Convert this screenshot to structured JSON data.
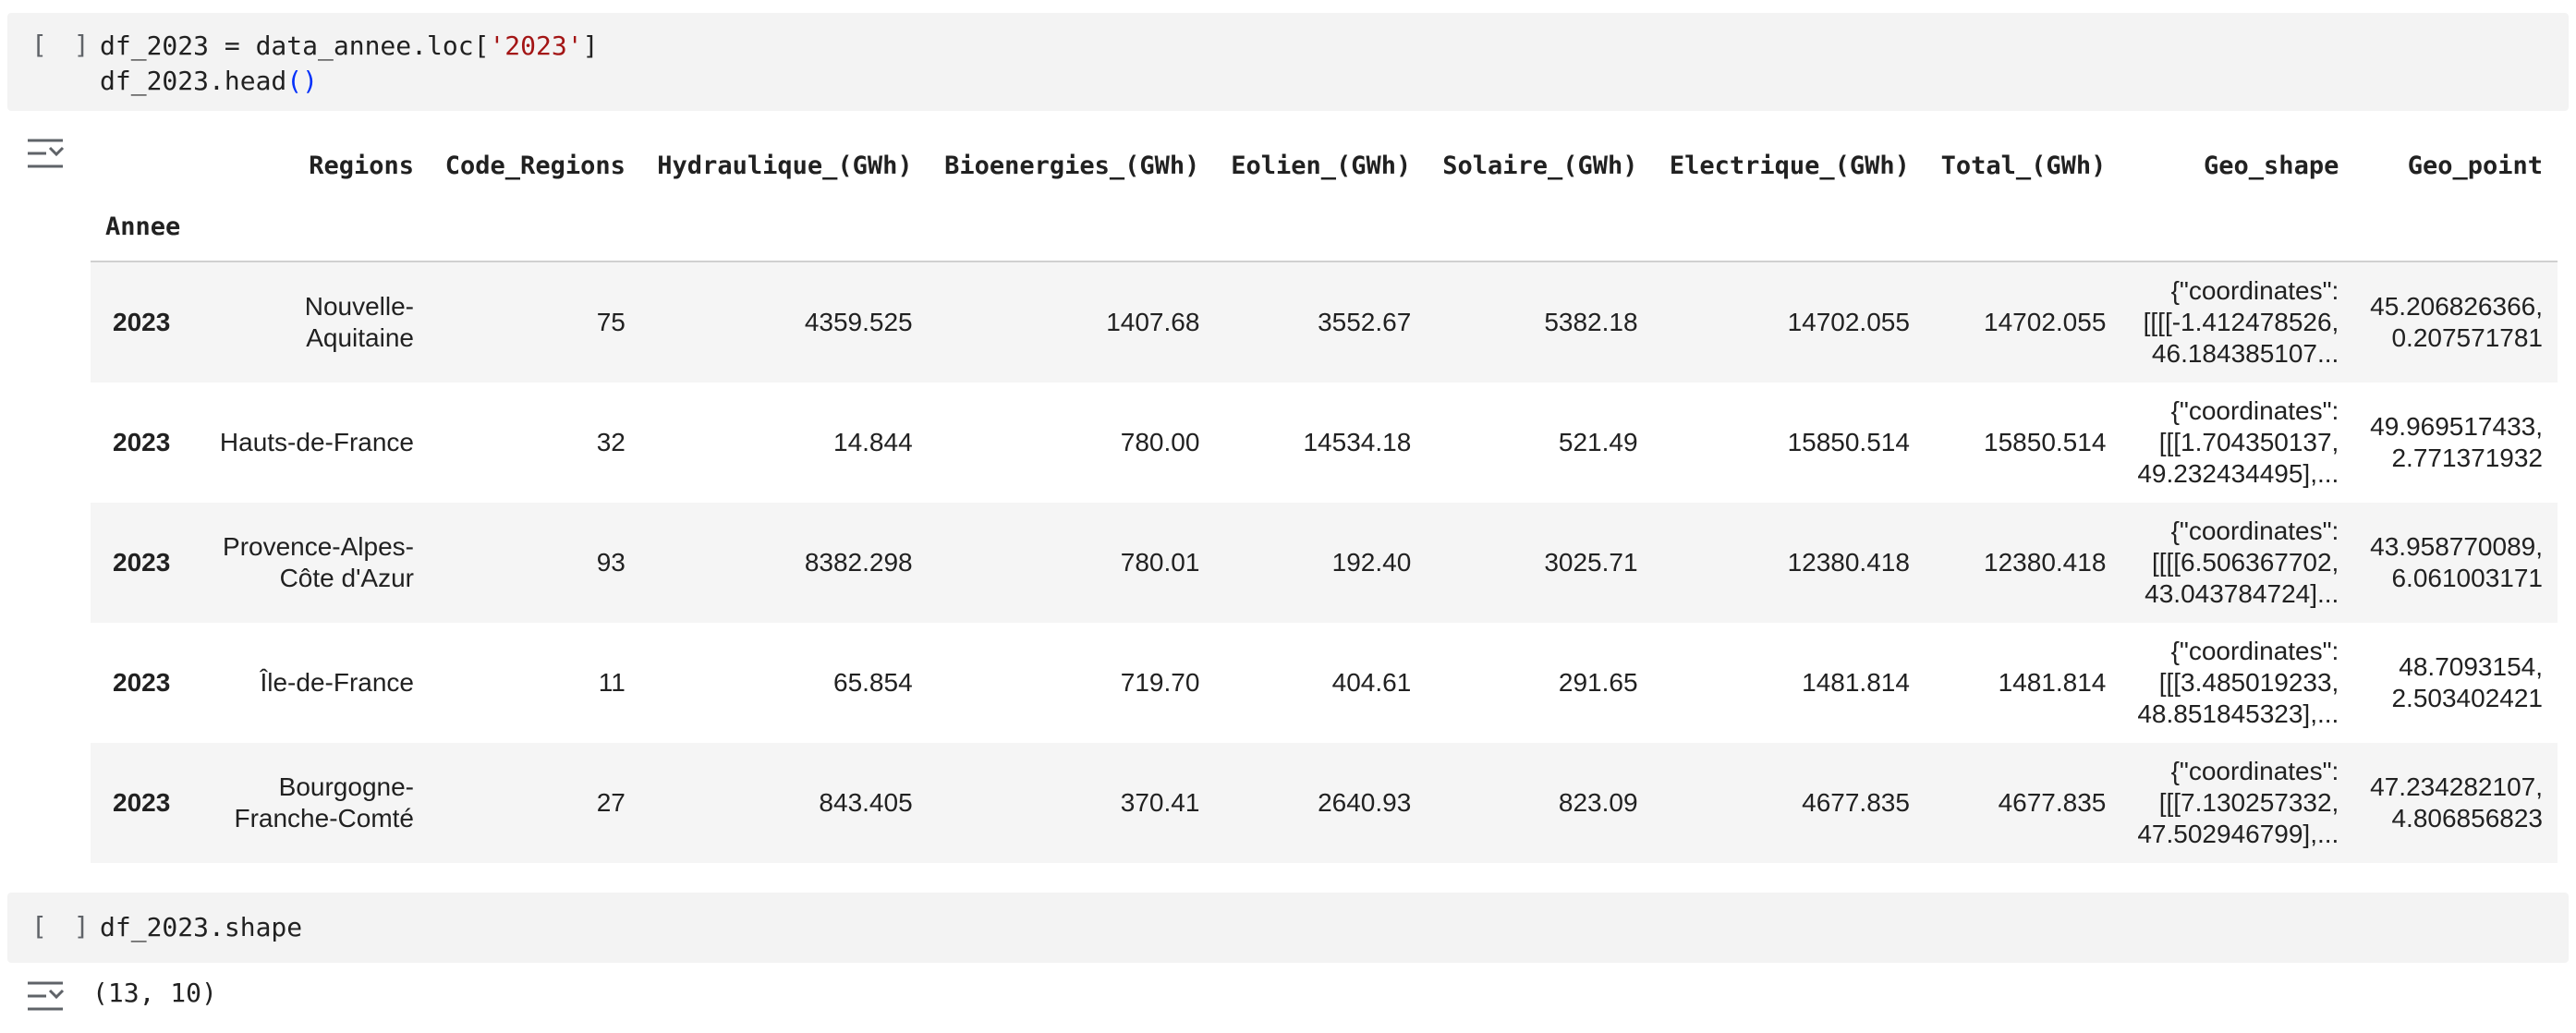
{
  "cell1": {
    "run_label": "[ ]",
    "code_line1_pre": "df_2023 = data_annee.loc[",
    "code_line1_str": "'2023'",
    "code_line1_post": "]",
    "code_line2_pre": "df_2023.head",
    "code_line2_paren": "()"
  },
  "output1": {
    "icon": "output-collapse-icon",
    "columns": [
      "Regions",
      "Code_Regions",
      "Hydraulique_(GWh)",
      "Bioenergies_(GWh)",
      "Eolien_(GWh)",
      "Solaire_(GWh)",
      "Electrique_(GWh)",
      "Total_(GWh)",
      "Geo_shape",
      "Geo_point"
    ],
    "index_name": "Annee",
    "rows": [
      {
        "annee": "2023",
        "regions": "Nouvelle-\nAquitaine",
        "code": "75",
        "hydraulique": "4359.525",
        "bioenergies": "1407.68",
        "eolien": "3552.67",
        "solaire": "5382.18",
        "electrique": "14702.055",
        "total": "14702.055",
        "geo_shape": "{\"coordinates\":\n[[[[-1.412478526,\n46.184385107...",
        "geo_point": "45.206826366,\n0.207571781"
      },
      {
        "annee": "2023",
        "regions": "Hauts-de-France",
        "code": "32",
        "hydraulique": "14.844",
        "bioenergies": "780.00",
        "eolien": "14534.18",
        "solaire": "521.49",
        "electrique": "15850.514",
        "total": "15850.514",
        "geo_shape": "{\"coordinates\":\n[[[1.704350137,\n49.232434495],...",
        "geo_point": "49.969517433,\n2.771371932"
      },
      {
        "annee": "2023",
        "regions": "Provence-Alpes-\nCôte d'Azur",
        "code": "93",
        "hydraulique": "8382.298",
        "bioenergies": "780.01",
        "eolien": "192.40",
        "solaire": "3025.71",
        "electrique": "12380.418",
        "total": "12380.418",
        "geo_shape": "{\"coordinates\":\n[[[[6.506367702,\n43.043784724]...",
        "geo_point": "43.958770089,\n6.061003171"
      },
      {
        "annee": "2023",
        "regions": "Île-de-France",
        "code": "11",
        "hydraulique": "65.854",
        "bioenergies": "719.70",
        "eolien": "404.61",
        "solaire": "291.65",
        "electrique": "1481.814",
        "total": "1481.814",
        "geo_shape": "{\"coordinates\":\n[[[3.485019233,\n48.851845323],...",
        "geo_point": "48.7093154,\n2.503402421"
      },
      {
        "annee": "2023",
        "regions": "Bourgogne-\nFranche-Comté",
        "code": "27",
        "hydraulique": "843.405",
        "bioenergies": "370.41",
        "eolien": "2640.93",
        "solaire": "823.09",
        "electrique": "4677.835",
        "total": "4677.835",
        "geo_shape": "{\"coordinates\":\n[[[7.130257332,\n47.502946799],...",
        "geo_point": "47.234282107,\n4.806856823"
      }
    ]
  },
  "cell2": {
    "run_label": "[ ]",
    "code": "df_2023.shape"
  },
  "output2": {
    "icon": "output-collapse-icon",
    "value": "(13, 10)"
  }
}
